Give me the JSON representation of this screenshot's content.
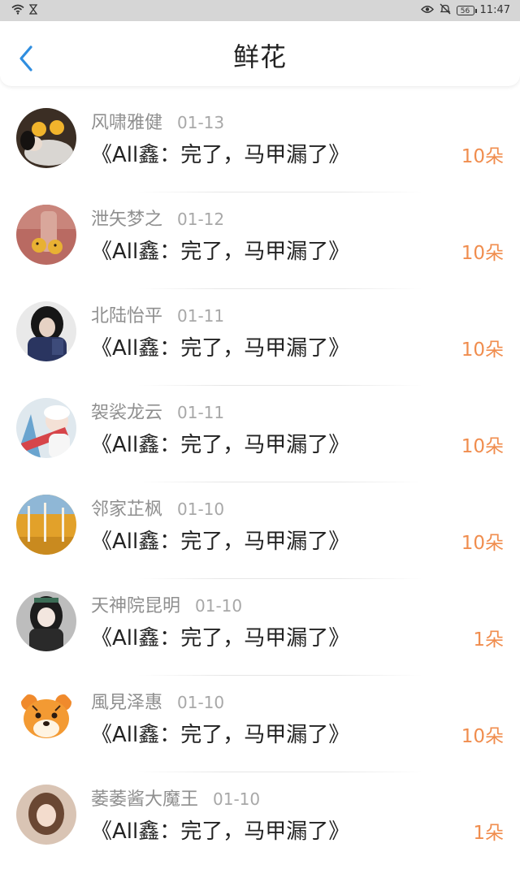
{
  "status_bar": {
    "time": "11:47",
    "battery": "56",
    "icons": [
      "wifi-icon",
      "hourglass-icon",
      "eye-icon",
      "mute-icon",
      "battery-icon"
    ]
  },
  "header": {
    "title": "鲜花",
    "back_icon": "chevron-left-icon"
  },
  "colors": {
    "accent": "#f08d4e",
    "back": "#2f8ee0",
    "status_bar_bg": "#d6d6d6"
  },
  "items": [
    {
      "user": "风啸雅健",
      "date": "01-13",
      "title": "《All鑫：完了，马甲漏了》",
      "count": "10朵"
    },
    {
      "user": "泄矢梦之",
      "date": "01-12",
      "title": "《All鑫：完了，马甲漏了》",
      "count": "10朵"
    },
    {
      "user": "北陆怡平",
      "date": "01-11",
      "title": "《All鑫：完了，马甲漏了》",
      "count": "10朵"
    },
    {
      "user": "袈裟龙云",
      "date": "01-11",
      "title": "《All鑫：完了，马甲漏了》",
      "count": "10朵"
    },
    {
      "user": "邻家芷枫",
      "date": "01-10",
      "title": "《All鑫：完了，马甲漏了》",
      "count": "10朵"
    },
    {
      "user": "天神院昆明",
      "date": "01-10",
      "title": "《All鑫：完了，马甲漏了》",
      "count": "1朵"
    },
    {
      "user": "風見泽惠",
      "date": "01-10",
      "title": "《All鑫：完了，马甲漏了》",
      "count": "10朵"
    },
    {
      "user": "萎萎酱大魔王",
      "date": "01-10",
      "title": "《All鑫：完了，马甲漏了》",
      "count": "1朵"
    }
  ]
}
